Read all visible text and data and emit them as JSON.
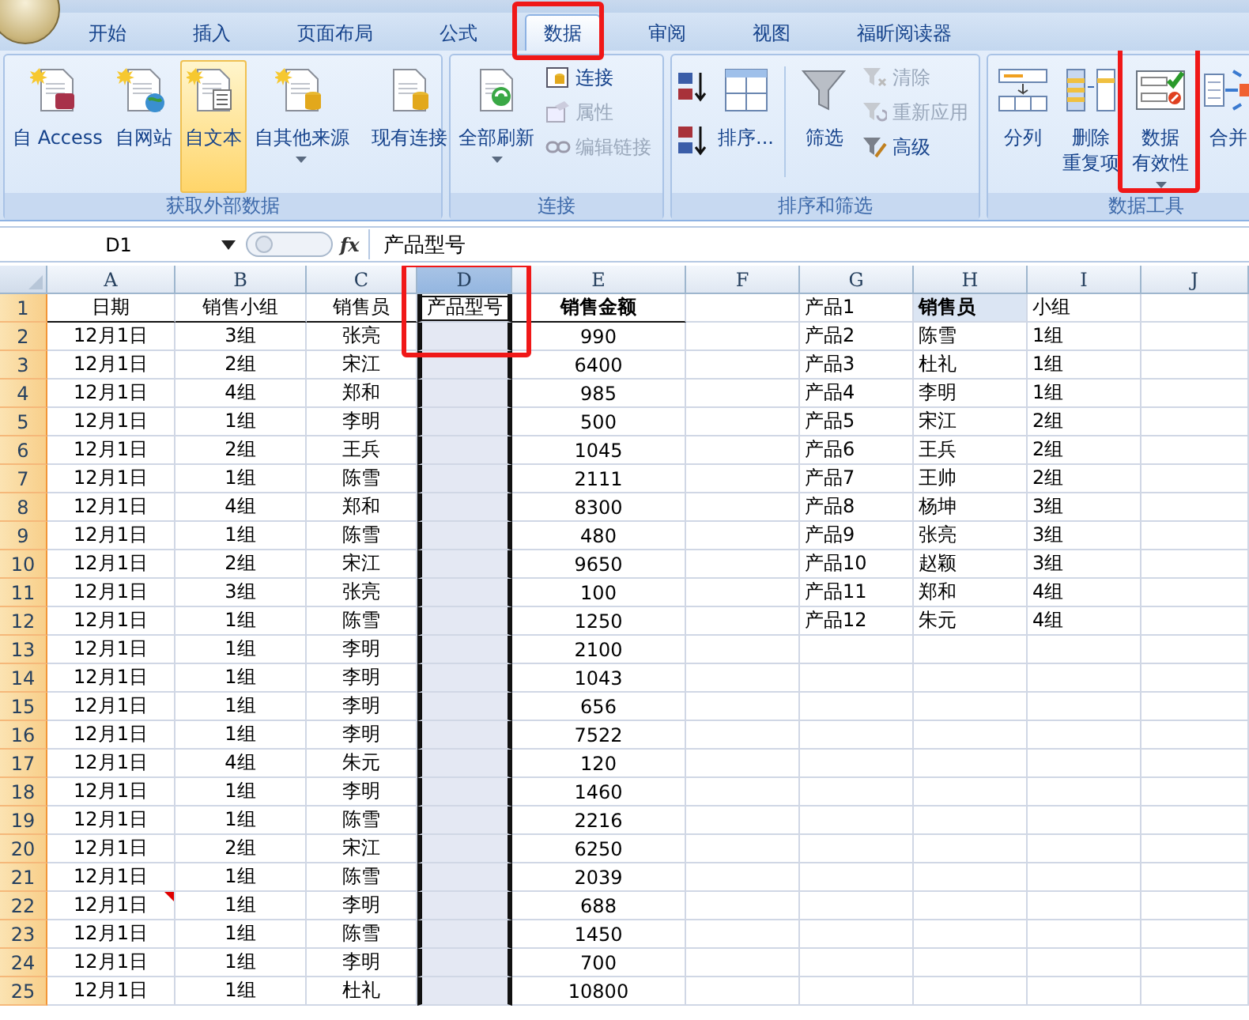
{
  "ribbon": {
    "tabs": [
      {
        "label": "开始",
        "selected": false,
        "marked": false
      },
      {
        "label": "插入",
        "selected": false,
        "marked": false
      },
      {
        "label": "页面布局",
        "selected": false,
        "marked": false
      },
      {
        "label": "公式",
        "selected": false,
        "marked": false
      },
      {
        "label": "数据",
        "selected": true,
        "marked": true
      },
      {
        "label": "审阅",
        "selected": false,
        "marked": false
      },
      {
        "label": "视图",
        "selected": false,
        "marked": false
      },
      {
        "label": "福昕阅读器",
        "selected": false,
        "marked": false
      }
    ],
    "groups": [
      {
        "label": "获取外部数据",
        "items": [
          {
            "kind": "large",
            "label": "自 Access",
            "highlighted": false,
            "menu": false,
            "marked": false
          },
          {
            "kind": "large",
            "label": "自网站",
            "highlighted": false,
            "menu": false,
            "marked": false
          },
          {
            "kind": "large",
            "label": "自文本",
            "highlighted": true,
            "menu": false,
            "marked": false
          },
          {
            "kind": "large",
            "label": "自其他来源",
            "highlighted": false,
            "menu": true,
            "marked": false
          },
          {
            "kind": "separator"
          },
          {
            "kind": "large",
            "label": "现有连接",
            "highlighted": false,
            "menu": false,
            "marked": false
          }
        ]
      },
      {
        "label": "连接",
        "items": [
          {
            "kind": "large",
            "label": "全部刷新",
            "highlighted": false,
            "menu": true,
            "marked": false
          },
          {
            "kind": "column",
            "buttons": [
              {
                "label": "连接",
                "disabled": false
              },
              {
                "label": "属性",
                "disabled": true
              },
              {
                "label": "编辑链接",
                "disabled": true
              }
            ]
          }
        ]
      },
      {
        "label": "排序和筛选",
        "items": [
          {
            "kind": "sort_pair"
          },
          {
            "kind": "large",
            "label": "排序...",
            "highlighted": false,
            "menu": false,
            "marked": false
          },
          {
            "kind": "separator"
          },
          {
            "kind": "large",
            "label": "筛选",
            "highlighted": false,
            "menu": false,
            "marked": false
          },
          {
            "kind": "column",
            "buttons": [
              {
                "label": "清除",
                "disabled": true
              },
              {
                "label": "重新应用",
                "disabled": true
              },
              {
                "label": "高级",
                "disabled": false
              }
            ]
          }
        ]
      },
      {
        "label": "数据工具",
        "items": [
          {
            "kind": "large",
            "label": "分列",
            "highlighted": false,
            "menu": false,
            "marked": false
          },
          {
            "kind": "large",
            "label_lines": [
              "删除",
              "重复项"
            ],
            "highlighted": false,
            "menu": false,
            "marked": false
          },
          {
            "kind": "large",
            "label_lines": [
              "数据",
              "有效性"
            ],
            "highlighted": false,
            "menu": true,
            "marked": true
          },
          {
            "kind": "large",
            "label": "合并",
            "highlighted": false,
            "menu": false,
            "marked": false
          }
        ]
      }
    ]
  },
  "formula_bar": {
    "name_box": "D1",
    "function_label": "fx",
    "formula": "产品型号"
  },
  "sheet": {
    "columns": [
      {
        "label": "A",
        "selected": false,
        "marked": false
      },
      {
        "label": "B",
        "selected": false,
        "marked": false
      },
      {
        "label": "C",
        "selected": false,
        "marked": false
      },
      {
        "label": "D",
        "selected": true,
        "marked": true
      },
      {
        "label": "E",
        "selected": false,
        "marked": false
      },
      {
        "label": "F",
        "selected": false,
        "marked": false
      },
      {
        "label": "G",
        "selected": false,
        "marked": false
      },
      {
        "label": "H",
        "selected": false,
        "marked": false
      },
      {
        "label": "I",
        "selected": false,
        "marked": false
      },
      {
        "label": "J",
        "selected": false,
        "marked": false
      }
    ],
    "rows": [
      {
        "number": "1",
        "cells": [
          "日期",
          "销售小组",
          "销售员",
          {
            "text": "产品型号",
            "active": true
          },
          {
            "text": "销售金额",
            "bold": true
          },
          null,
          "产品1",
          {
            "text": "销售员",
            "bold": true,
            "highlighted": true
          },
          "小组"
        ]
      },
      {
        "number": "2",
        "cells": [
          "12月1日",
          "3组",
          "张亮",
          null,
          "990",
          null,
          "产品2",
          "陈雪",
          "1组"
        ]
      },
      {
        "number": "3",
        "cells": [
          "12月1日",
          "2组",
          "宋江",
          null,
          "6400",
          null,
          "产品3",
          "杜礼",
          "1组"
        ]
      },
      {
        "number": "4",
        "cells": [
          "12月1日",
          "4组",
          "郑和",
          null,
          "985",
          null,
          "产品4",
          "李明",
          "1组"
        ]
      },
      {
        "number": "5",
        "cells": [
          "12月1日",
          "1组",
          "李明",
          null,
          "500",
          null,
          "产品5",
          "宋江",
          "2组"
        ]
      },
      {
        "number": "6",
        "cells": [
          "12月1日",
          "2组",
          "王兵",
          null,
          "1045",
          null,
          "产品6",
          "王兵",
          "2组"
        ]
      },
      {
        "number": "7",
        "cells": [
          "12月1日",
          "1组",
          "陈雪",
          null,
          "2111",
          null,
          "产品7",
          "王帅",
          "2组"
        ]
      },
      {
        "number": "8",
        "cells": [
          "12月1日",
          "4组",
          "郑和",
          null,
          "8300",
          null,
          "产品8",
          "杨坤",
          "3组"
        ]
      },
      {
        "number": "9",
        "cells": [
          "12月1日",
          "1组",
          "陈雪",
          null,
          "480",
          null,
          "产品9",
          "张亮",
          "3组"
        ]
      },
      {
        "number": "10",
        "cells": [
          "12月1日",
          "2组",
          "宋江",
          null,
          "9650",
          null,
          "产品10",
          "赵颖",
          "3组"
        ]
      },
      {
        "number": "11",
        "cells": [
          "12月1日",
          "3组",
          "张亮",
          null,
          "100",
          null,
          "产品11",
          "郑和",
          "4组"
        ]
      },
      {
        "number": "12",
        "cells": [
          "12月1日",
          "1组",
          "陈雪",
          null,
          "1250",
          null,
          "产品12",
          "朱元",
          "4组"
        ]
      },
      {
        "number": "13",
        "cells": [
          "12月1日",
          "1组",
          "李明",
          null,
          "2100"
        ]
      },
      {
        "number": "14",
        "cells": [
          "12月1日",
          "1组",
          "李明",
          null,
          "1043"
        ]
      },
      {
        "number": "15",
        "cells": [
          "12月1日",
          "1组",
          "李明",
          null,
          "656"
        ]
      },
      {
        "number": "16",
        "cells": [
          "12月1日",
          "1组",
          "李明",
          null,
          "7522"
        ]
      },
      {
        "number": "17",
        "cells": [
          "12月1日",
          "4组",
          "朱元",
          null,
          "120"
        ]
      },
      {
        "number": "18",
        "cells": [
          "12月1日",
          "1组",
          "李明",
          null,
          "1460"
        ]
      },
      {
        "number": "19",
        "cells": [
          "12月1日",
          "1组",
          "陈雪",
          null,
          "2216"
        ]
      },
      {
        "number": "20",
        "cells": [
          "12月1日",
          "2组",
          "宋江",
          null,
          "6250"
        ]
      },
      {
        "number": "21",
        "cells": [
          "12月1日",
          "1组",
          "陈雪",
          null,
          "2039"
        ]
      },
      {
        "number": "22",
        "cells": [
          {
            "text": "12月1日",
            "comment": true
          },
          "1组",
          "李明",
          null,
          "688"
        ]
      },
      {
        "number": "23",
        "cells": [
          "12月1日",
          "1组",
          "陈雪",
          null,
          "1450"
        ]
      },
      {
        "number": "24",
        "cells": [
          "12月1日",
          "1组",
          "李明",
          null,
          "700"
        ]
      },
      {
        "number": "25",
        "cells": [
          "12月1日",
          "1组",
          "杜礼",
          null,
          "10800"
        ]
      }
    ]
  }
}
